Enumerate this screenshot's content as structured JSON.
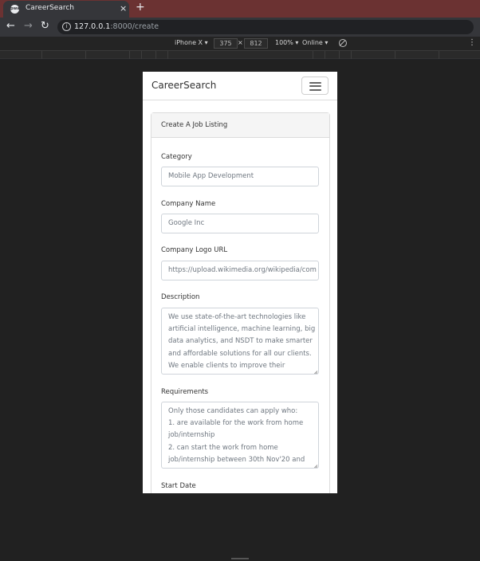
{
  "browser": {
    "tab_title": "CareerSearch",
    "tab_favicon_text": "pwa",
    "close_glyph": "×",
    "new_tab_glyph": "+",
    "url_host": "127.0.0.1",
    "url_path": ":8000/create"
  },
  "device_toolbar": {
    "device": "iPhone X ▾",
    "width": "375",
    "times": "×",
    "height": "812",
    "zoom": "100% ▾",
    "network": "Online ▾"
  },
  "page": {
    "brand": "CareerSearch",
    "card_title": "Create A Job Listing",
    "fields": {
      "category": {
        "label": "Category",
        "placeholder": "Mobile App Development"
      },
      "company_name": {
        "label": "Company Name",
        "placeholder": "Google Inc"
      },
      "logo_url": {
        "label": "Company Logo URL",
        "placeholder": "https://upload.wikimedia.org/wikipedia/com"
      },
      "description": {
        "label": "Description",
        "lines": [
          " We use state-of-the-art technologies like",
          "artificial intelligence, machine learning, big",
          "data analytics, and NSDT to make smarter",
          "and affordable solutions for all our clients.",
          "We enable clients to improve their"
        ]
      },
      "requirements": {
        "label": "Requirements",
        "lines": [
          "Only those candidates can apply who:",
          "1. are available for the work from home",
          "job/internship",
          "2. can start the work from home",
          "job/internship between 30th Nov'20 and"
        ]
      },
      "start_date": {
        "label": "Start Date"
      }
    }
  }
}
